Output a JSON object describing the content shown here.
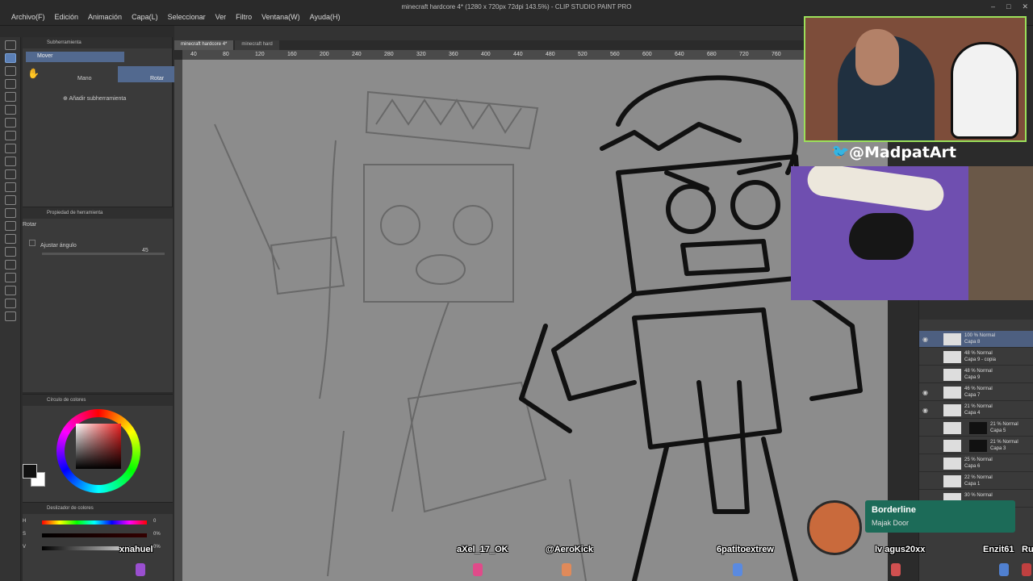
{
  "window": {
    "title": "minecraft hardcore 4* (1280 x 720px 72dpi 143.5%) - CLIP STUDIO PAINT PRO"
  },
  "menu": [
    "Archivo(F)",
    "Edición",
    "Animación",
    "Capa(L)",
    "Seleccionar",
    "Ver",
    "Filtro",
    "Ventana(W)",
    "Ayuda(H)"
  ],
  "subtool_panel": {
    "tab": "Subherramienta",
    "selected": "Mover",
    "mano_label": "Mano",
    "rotar_label": "Rotar",
    "add_label": "Añadir subherramienta"
  },
  "tool_property": {
    "title": "Propiedad de herramienta",
    "tool": "Rotar",
    "angle_label": "Ajustar ángulo",
    "angle_value": "45"
  },
  "color_circle": {
    "title": "Círculo de colores",
    "values": [
      "0",
      "0",
      "0"
    ]
  },
  "color_slider": {
    "title": "Deslizador de colores",
    "rows": [
      {
        "label": "H",
        "value": "0"
      },
      {
        "label": "S",
        "value": "0%"
      },
      {
        "label": "V",
        "value": "0%"
      }
    ]
  },
  "tabs": [
    "minecraft hardcore 4*",
    "minecraft hard"
  ],
  "ruler": [
    "40",
    "80",
    "120",
    "160",
    "200",
    "240",
    "280",
    "320",
    "360",
    "400",
    "440",
    "480",
    "520",
    "560",
    "600",
    "640",
    "680",
    "720",
    "760"
  ],
  "layers": [
    {
      "mode": "100 % Normal",
      "name": "Capa 8",
      "selected": true,
      "eye": true
    },
    {
      "mode": "48 % Normal",
      "name": "Capa 9 - copia",
      "selected": false,
      "eye": false
    },
    {
      "mode": "48 % Normal",
      "name": "Capa 9",
      "selected": false,
      "eye": false
    },
    {
      "mode": "46 % Normal",
      "name": "Capa 7",
      "selected": false,
      "eye": true
    },
    {
      "mode": "21 % Normal",
      "name": "Capa 4",
      "selected": false,
      "eye": true
    },
    {
      "mode": "21 % Normal",
      "name": "Capa 5",
      "selected": false,
      "eye": false,
      "mask": true
    },
    {
      "mode": "21 % Normal",
      "name": "Capa 3",
      "selected": false,
      "eye": false,
      "mask": true
    },
    {
      "mode": "25 % Normal",
      "name": "Capa 6",
      "selected": false,
      "eye": false
    },
    {
      "mode": "22 % Normal",
      "name": "Capa 1",
      "selected": false,
      "eye": false
    },
    {
      "mode": "30 % Normal",
      "name": "",
      "selected": false,
      "eye": false
    }
  ],
  "overlay": {
    "twitter_handle": "@MadpatArt",
    "song": "Borderline",
    "artist": "Majak Door",
    "viewers": [
      {
        "name": "xnahuel",
        "color": "#9a4fd0"
      },
      {
        "name": "aXel_17_OK",
        "color": "#e04b8a"
      },
      {
        "name": "@AeroKick",
        "color": "#e08a5a"
      },
      {
        "name": "6patitoextrew",
        "color": "#5a8ae0"
      },
      {
        "name": "lv agus20xx",
        "color": "#d05050"
      },
      {
        "name": "Enzit61",
        "color": "#5080d0"
      },
      {
        "name": "Ru",
        "color": "#c04040"
      }
    ]
  }
}
